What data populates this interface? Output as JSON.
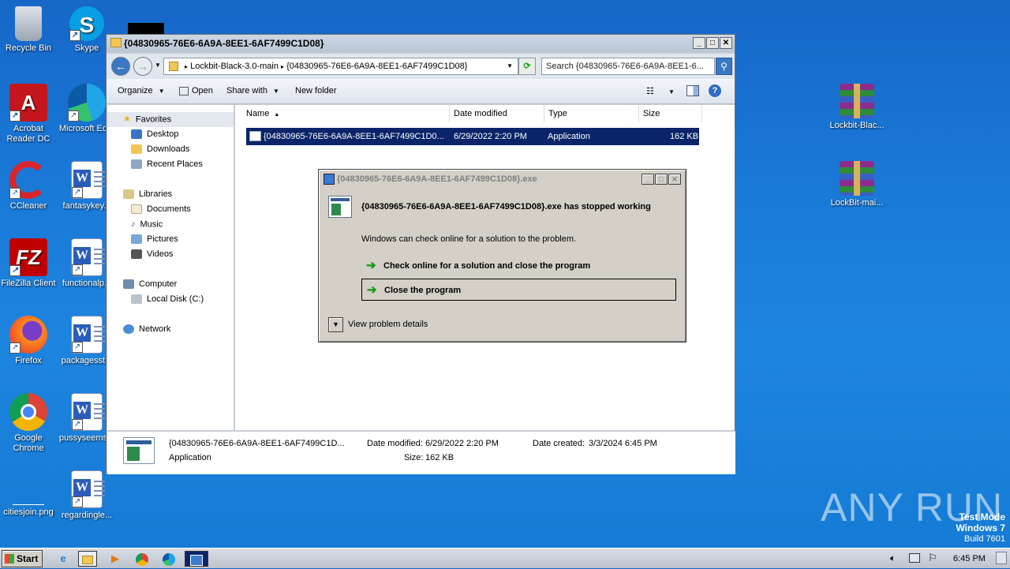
{
  "desktop": {
    "icons_left": [
      {
        "label": "Recycle Bin"
      },
      {
        "label": "Acrobat Reader DC"
      },
      {
        "label": "CCleaner"
      },
      {
        "label": "FileZilla Client"
      },
      {
        "label": "Firefox"
      },
      {
        "label": "Google Chrome"
      },
      {
        "label": "citiesjoin.png"
      }
    ],
    "icons_second": [
      {
        "label": "Skype"
      },
      {
        "label": "Microsoft Ed..."
      },
      {
        "label": "fantasykey..."
      },
      {
        "label": "functionalp..."
      },
      {
        "label": "packagesst..."
      },
      {
        "label": "pussyseems..."
      },
      {
        "label": "regardingle..."
      }
    ],
    "icons_right": [
      {
        "label": "Lockbit-Blac..."
      },
      {
        "label": "LockBit-mai..."
      }
    ]
  },
  "explorer": {
    "title": "{04830965-76E6-6A9A-8EE1-6AF7499C1D08}",
    "address": {
      "crumb1": "Lockbit-Black-3.0-main",
      "crumb2": "{04830965-76E6-6A9A-8EE1-6AF7499C1D08}",
      "search_placeholder": "Search {04830965-76E6-6A9A-8EE1-6..."
    },
    "toolbar": {
      "organize": "Organize",
      "open": "Open",
      "share_with": "Share with",
      "new_folder": "New folder"
    },
    "nav": {
      "favorites": "Favorites",
      "desktop": "Desktop",
      "downloads": "Downloads",
      "recent_places": "Recent Places",
      "libraries": "Libraries",
      "documents": "Documents",
      "music": "Music",
      "pictures": "Pictures",
      "videos": "Videos",
      "computer": "Computer",
      "local_disk": "Local Disk (C:)",
      "network": "Network"
    },
    "columns": {
      "name": "Name",
      "date_modified": "Date modified",
      "type": "Type",
      "size": "Size"
    },
    "files": [
      {
        "name": "{04830965-76E6-6A9A-8EE1-6AF7499C1D0...",
        "date": "6/29/2022 2:20 PM",
        "type": "Application",
        "size": "162 KB"
      }
    ],
    "details": {
      "name": "{04830965-76E6-6A9A-8EE1-6AF7499C1D...",
      "type": "Application",
      "date_modified_label": "Date modified:",
      "date_modified": "6/29/2022 2:20 PM",
      "size_label": "Size:",
      "size": "162 KB",
      "date_created_label": "Date created:",
      "date_created": "3/3/2024 6:45 PM"
    }
  },
  "dialog": {
    "title": "{04830965-76E6-6A9A-8EE1-6AF7499C1D08}.exe",
    "heading": "{04830965-76E6-6A9A-8EE1-6AF7499C1D08}.exe has stopped working",
    "subtext": "Windows can check online for a solution to the problem.",
    "option1": "Check online for a solution and close the program",
    "option2": "Close the program",
    "details_toggle": "View problem details"
  },
  "watermark": "ANY RUN",
  "testmode": {
    "line1": "Test Mode",
    "line2": "Windows 7",
    "line3": "Build 7601"
  },
  "taskbar": {
    "start": "Start",
    "clock": "6:45 PM"
  }
}
